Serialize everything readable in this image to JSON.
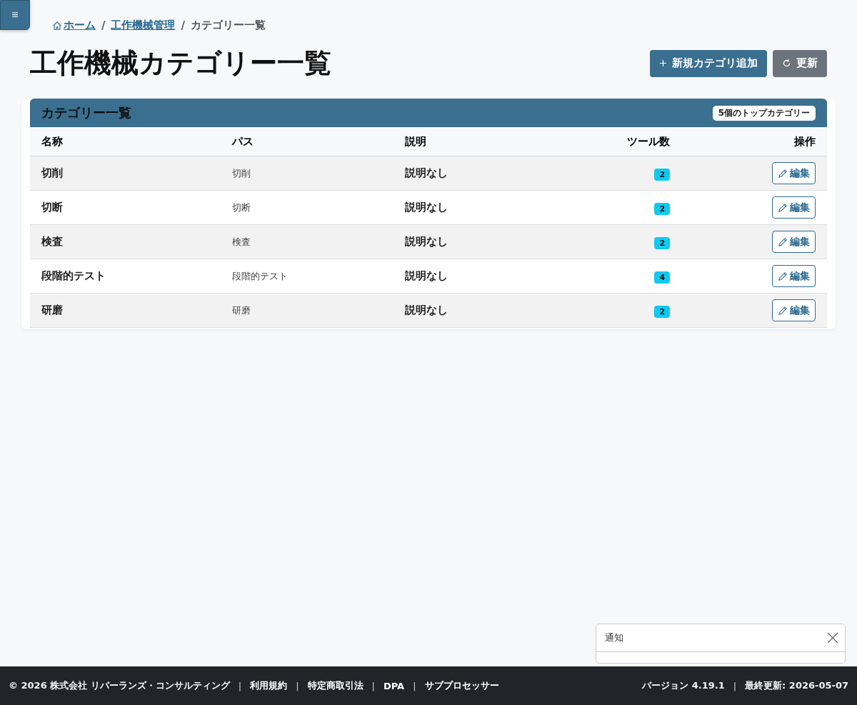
{
  "menu_button": {
    "label": "≡"
  },
  "breadcrumb": [
    {
      "kind": "home",
      "label": "ホーム"
    },
    {
      "kind": "separator",
      "label": "/"
    },
    {
      "kind": "link",
      "label": "工作機械管理"
    },
    {
      "kind": "separator",
      "label": "/"
    },
    {
      "kind": "current",
      "label": "カテゴリー一覧"
    }
  ],
  "page_title": "工作機械カテゴリー一覧",
  "actions": [
    {
      "kind": "add",
      "label": "新規カテゴリ追加"
    },
    {
      "kind": "refresh",
      "label": "更新"
    }
  ],
  "card": {
    "title": "カテゴリー一覧",
    "badge": "5個のトップカテゴリー"
  },
  "table": {
    "columns": [
      "名称",
      "パス",
      "説明",
      "ツール数",
      "操作"
    ],
    "rows": [
      {
        "name": "切削",
        "path": "切削",
        "description": "説明なし",
        "tools": "2",
        "action": "編集"
      },
      {
        "name": "切断",
        "path": "切断",
        "description": "説明なし",
        "tools": "2",
        "action": "編集"
      },
      {
        "name": "検査",
        "path": "検査",
        "description": "説明なし",
        "tools": "2",
        "action": "編集"
      },
      {
        "name": "段階的テスト",
        "path": "段階的テスト",
        "description": "説明なし",
        "tools": "4",
        "action": "編集"
      },
      {
        "name": "研磨",
        "path": "研磨",
        "description": "説明なし",
        "tools": "2",
        "action": "編集"
      }
    ]
  },
  "footer": {
    "left": [
      {
        "kind": "text",
        "label": "© 2026 株式会社 リバーランズ・コンサルティング"
      },
      {
        "kind": "separator",
        "label": "|"
      },
      {
        "kind": "link",
        "label": "利用規約"
      },
      {
        "kind": "separator",
        "label": "|"
      },
      {
        "kind": "link",
        "label": "特定商取引法"
      },
      {
        "kind": "separator",
        "label": "|"
      },
      {
        "kind": "link",
        "label": "DPA"
      },
      {
        "kind": "separator",
        "label": "|"
      },
      {
        "kind": "link",
        "label": "サブプロセッサー"
      }
    ],
    "right": [
      {
        "kind": "text",
        "label": "バージョン 4.19.1"
      },
      {
        "kind": "separator",
        "label": "|"
      },
      {
        "kind": "text",
        "label": "最終更新: 2026-05-07"
      }
    ]
  },
  "toast": {
    "title": "通知"
  }
}
